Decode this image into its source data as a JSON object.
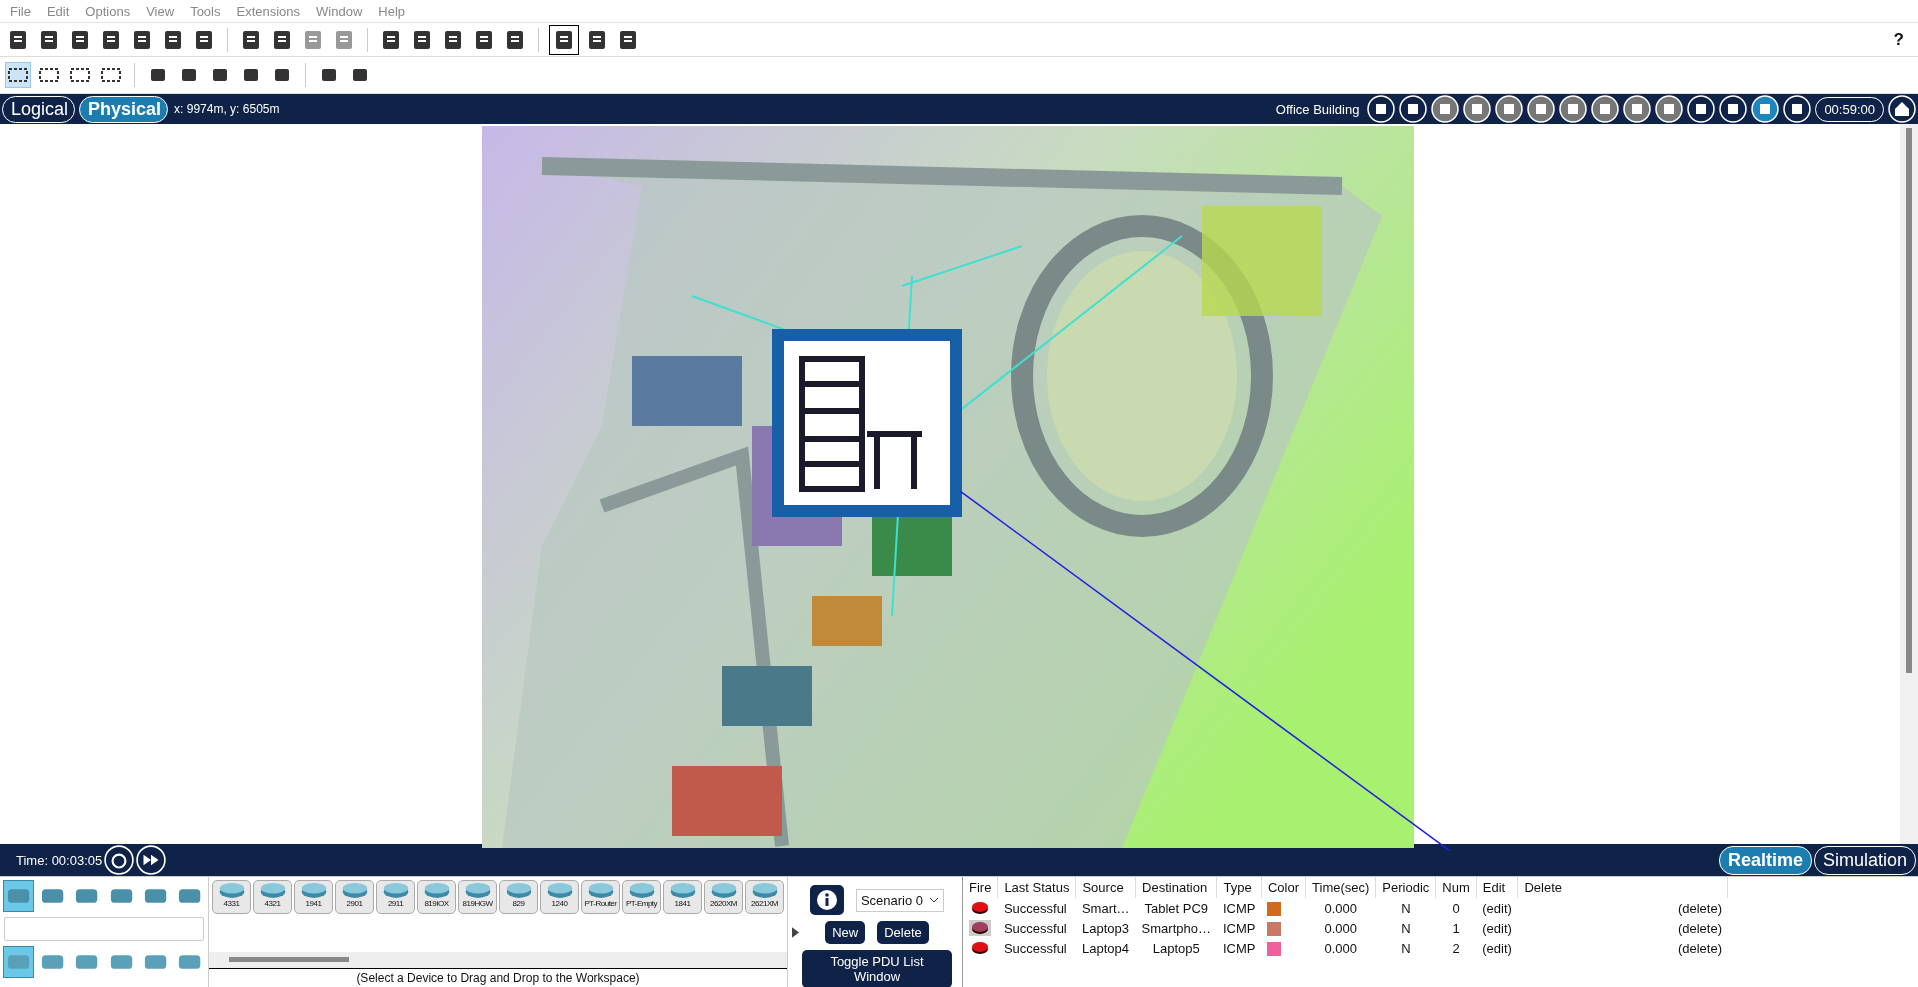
{
  "menu": [
    "File",
    "Edit",
    "Options",
    "View",
    "Tools",
    "Extensions",
    "Window",
    "Help"
  ],
  "help_mark": "?",
  "tools": [
    {
      "selected": true
    },
    {
      "selected": false
    },
    {
      "selected": false
    },
    {
      "selected": false
    }
  ],
  "view_tabs": [
    {
      "label": "Logical",
      "selected": false
    },
    {
      "label": "Physical",
      "selected": true
    }
  ],
  "coordinates": "x: 9974m, y: 6505m",
  "location": "Office Building",
  "clock": "00:59:00",
  "time": "Time: 00:03:05",
  "modes": [
    {
      "label": "Realtime",
      "selected": true
    },
    {
      "label": "Simulation",
      "selected": false
    }
  ],
  "device_categories": [
    {
      "selected": true
    },
    {
      "selected": false
    },
    {
      "selected": false
    },
    {
      "selected": false
    },
    {
      "selected": false
    },
    {
      "selected": false
    }
  ],
  "device_subcategories": [
    {
      "selected": true
    },
    {
      "selected": false
    },
    {
      "selected": false
    },
    {
      "selected": false
    },
    {
      "selected": false
    },
    {
      "selected": false
    }
  ],
  "devices": [
    "4331",
    "4321",
    "1941",
    "2901",
    "2911",
    "819IOX",
    "819HGW",
    "829",
    "1240",
    "PT-Router",
    "PT-Empty",
    "1841",
    "2620XM",
    "2621XM"
  ],
  "device_hint": "(Select a Device to Drag and Drop to the Workspace)",
  "scenario": "Scenario 0",
  "pdu_buttons": [
    "New",
    "Delete"
  ],
  "toggle_button": "Toggle PDU List Window",
  "pdu_table": {
    "columns": [
      "Fire",
      "Last Status",
      "Source",
      "Destination",
      "Type",
      "Color",
      "Time(sec)",
      "Periodic",
      "Num",
      "Edit",
      "Delete"
    ],
    "rows": [
      {
        "selected": false,
        "last_status": "Successful",
        "source": "Smart…",
        "destination": "Tablet PC9",
        "type": "ICMP",
        "color": "#d2691e",
        "time": "0.000",
        "periodic": "N",
        "num": "0",
        "edit": "(edit)",
        "delete": "(delete)"
      },
      {
        "selected": true,
        "last_status": "Successful",
        "source": "Laptop3",
        "destination": "Smartpho…",
        "type": "ICMP",
        "color": "#c87864",
        "time": "0.000",
        "periodic": "N",
        "num": "1",
        "edit": "(edit)",
        "delete": "(delete)"
      },
      {
        "selected": false,
        "last_status": "Successful",
        "source": "Laptop4",
        "destination": "Laptop5",
        "type": "ICMP",
        "color": "#f0609c",
        "time": "0.000",
        "periodic": "N",
        "num": "2",
        "edit": "(edit)",
        "delete": "(delete)"
      }
    ]
  }
}
